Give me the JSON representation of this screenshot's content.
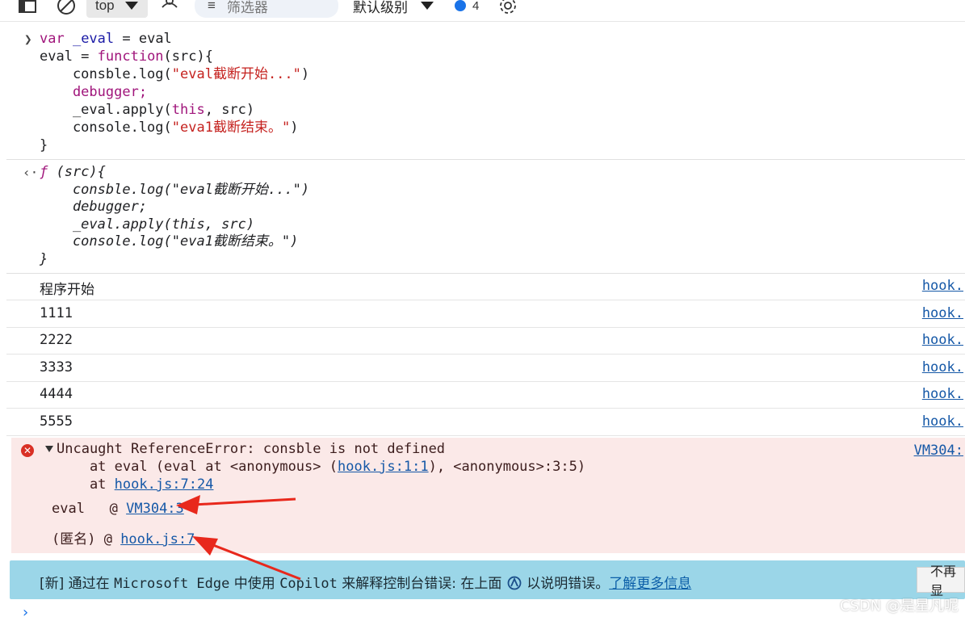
{
  "toolbar": {
    "context_select": "top",
    "filter_placeholder": "筛选器",
    "level_select": "默认级别",
    "issues_count": "4"
  },
  "input_code": {
    "line1_a": "var ",
    "line1_b": "_eval",
    "line1_c": " = eval",
    "line2_a": "eval = ",
    "line2_b": "function",
    "line2_c": "(src){",
    "line3_a": "    consble.log(",
    "line3_b": "\"eval截断开始...\"",
    "line3_c": ")",
    "line4": "    debugger;",
    "line5_a": "    _eval.apply(",
    "line5_b": "this",
    "line5_c": ", src)",
    "line6_a": "    console.log(",
    "line6_b": "\"eva1截断结束。\"",
    "line6_c": ")",
    "line7": "}"
  },
  "result_code": {
    "line1_a": "ƒ",
    "line1_b": " (src){",
    "line2": "    consble.log(\"eval截断开始...\")",
    "line3": "    debugger;",
    "line4": "    _eval.apply(this, src)",
    "line5": "    console.log(\"eva1截断结束。\")",
    "line6": "}"
  },
  "logs": [
    {
      "text": "程序开始",
      "source": "hook."
    },
    {
      "text": "1111",
      "source": "hook."
    },
    {
      "text": "2222",
      "source": "hook."
    },
    {
      "text": "3333",
      "source": "hook."
    },
    {
      "text": "4444",
      "source": "hook."
    },
    {
      "text": "5555",
      "source": "hook."
    }
  ],
  "error": {
    "message": "Uncaught ReferenceError: consble is not defined",
    "source": "VM304:",
    "trace1_a": "    at eval (eval at <anonymous> (",
    "trace1_link": "hook.js:1:1",
    "trace1_b": "), <anonymous>:3:5)",
    "trace2_a": "    at ",
    "trace2_link": "hook.js:7:24",
    "frame1_name": "eval   @ ",
    "frame1_link": "VM304:3",
    "frame2_name": "(匿名) @ ",
    "frame2_link": "hook.js:7"
  },
  "copilot": {
    "prefix": "[新] 通过在 ",
    "product": "Microsoft Edge",
    "mid": " 中使用 ",
    "copilot": "Copilot",
    "suffix": " 来解释控制台错误: 在上面 ",
    "tail": " 以说明错误。",
    "learn_more": "了解更多信息",
    "dismiss": "不再显"
  },
  "watermark": "CSDN @是星凡呢",
  "colors": {
    "error_bg": "#fbe9e8",
    "copilot_bg": "#9bd6e8",
    "link": "#1558a7",
    "arrow": "#e8281c"
  }
}
